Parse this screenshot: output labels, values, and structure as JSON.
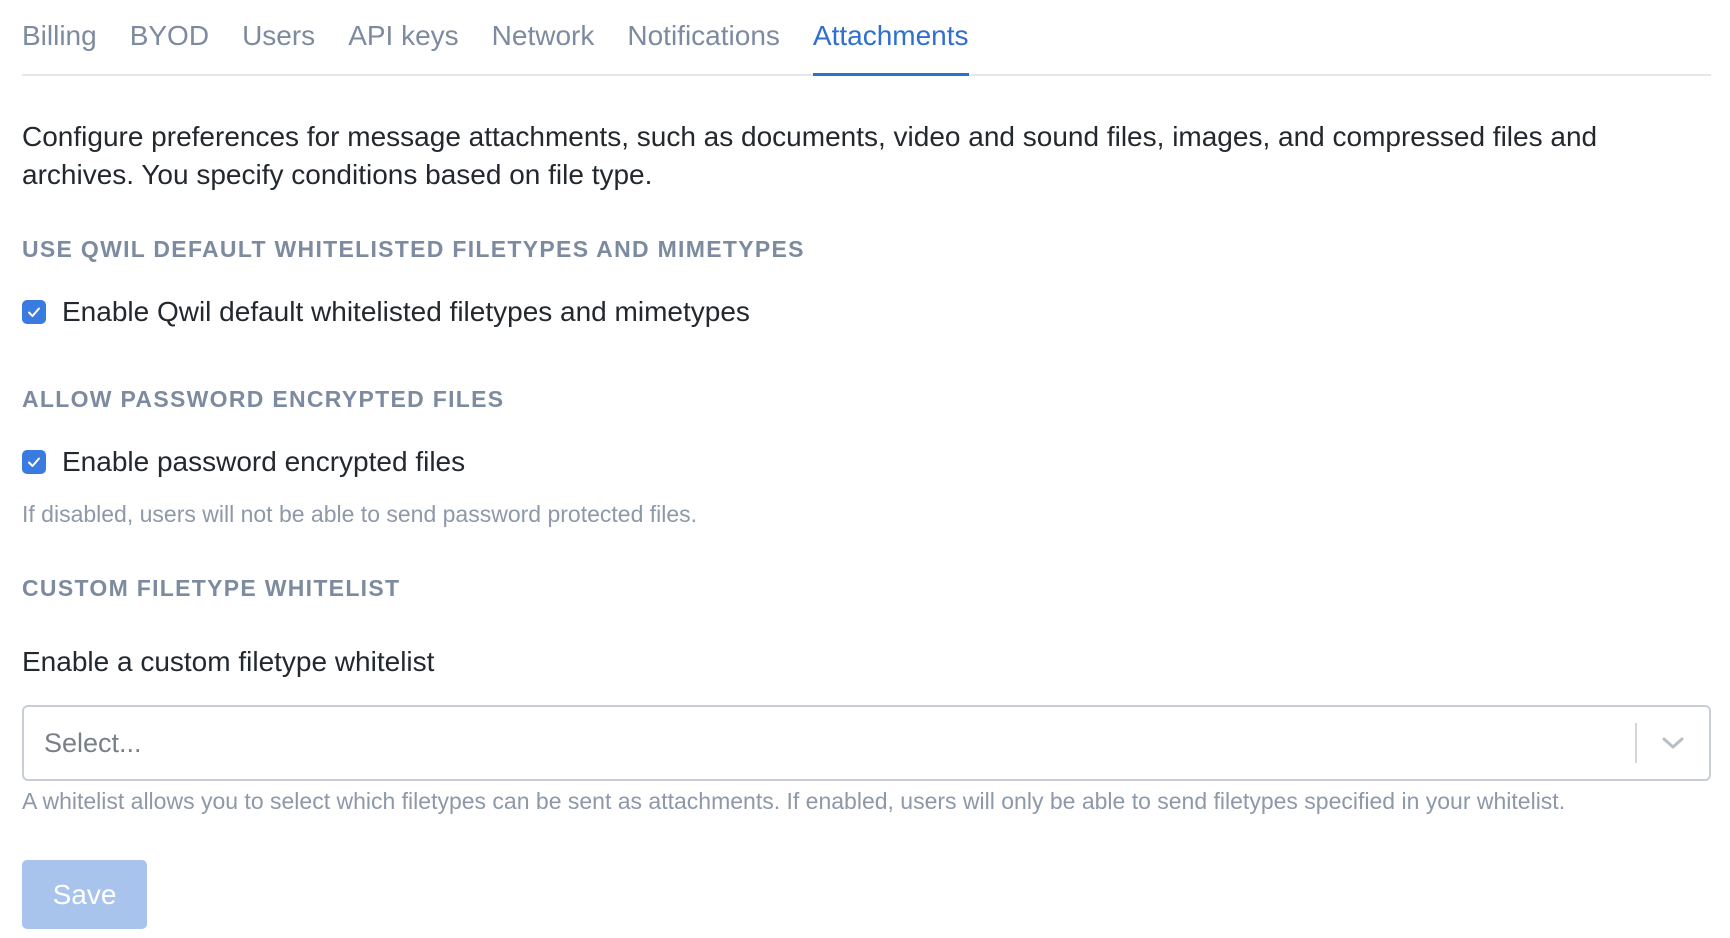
{
  "tabs": [
    {
      "label": "Billing",
      "active": false
    },
    {
      "label": "BYOD",
      "active": false
    },
    {
      "label": "Users",
      "active": false
    },
    {
      "label": "API keys",
      "active": false
    },
    {
      "label": "Network",
      "active": false
    },
    {
      "label": "Notifications",
      "active": false
    },
    {
      "label": "Attachments",
      "active": true
    }
  ],
  "intro": "Configure preferences for message attachments, such as documents, video and sound files, images, and compressed files and archives. You specify conditions based on file type.",
  "sections": {
    "default_whitelist": {
      "title": "USE QWIL DEFAULT WHITELISTED FILETYPES AND MIMETYPES",
      "checkbox_label": "Enable Qwil default whitelisted filetypes and mimetypes",
      "checked": true
    },
    "password_encrypted": {
      "title": "ALLOW PASSWORD ENCRYPTED FILES",
      "checkbox_label": "Enable password encrypted files",
      "checked": true,
      "hint": "If disabled, users will not be able to send password protected files."
    },
    "custom_whitelist": {
      "title": "CUSTOM FILETYPE WHITELIST",
      "field_label": "Enable a custom filetype whitelist",
      "select_placeholder": "Select...",
      "hint": "A whitelist allows you to select which filetypes can be sent as attachments. If enabled, users will only be able to send filetypes specified in your whitelist."
    }
  },
  "save_label": "Save",
  "colors": {
    "accent": "#2f6fd0",
    "checkbox": "#3a7be0",
    "muted_text": "#7d8ba0",
    "save_disabled": "#a9c4ec"
  },
  "icons": {
    "checkbox_check": "check-icon",
    "select_toggle": "chevron-down-icon"
  }
}
